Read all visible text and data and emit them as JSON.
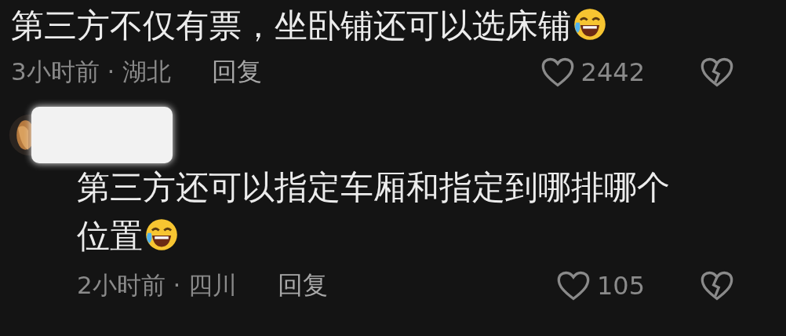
{
  "comments": [
    {
      "text": "第三方不仅有票，坐卧铺还可以选床铺",
      "meta": "3小时前 · 湖北",
      "reply_label": "回复",
      "likes": "2442",
      "replies": [
        {
          "text": "第三方还可以指定车厢和指定到哪排哪个位置",
          "meta": "2小时前 · 四川",
          "reply_label": "回复",
          "likes": "105"
        }
      ]
    }
  ]
}
